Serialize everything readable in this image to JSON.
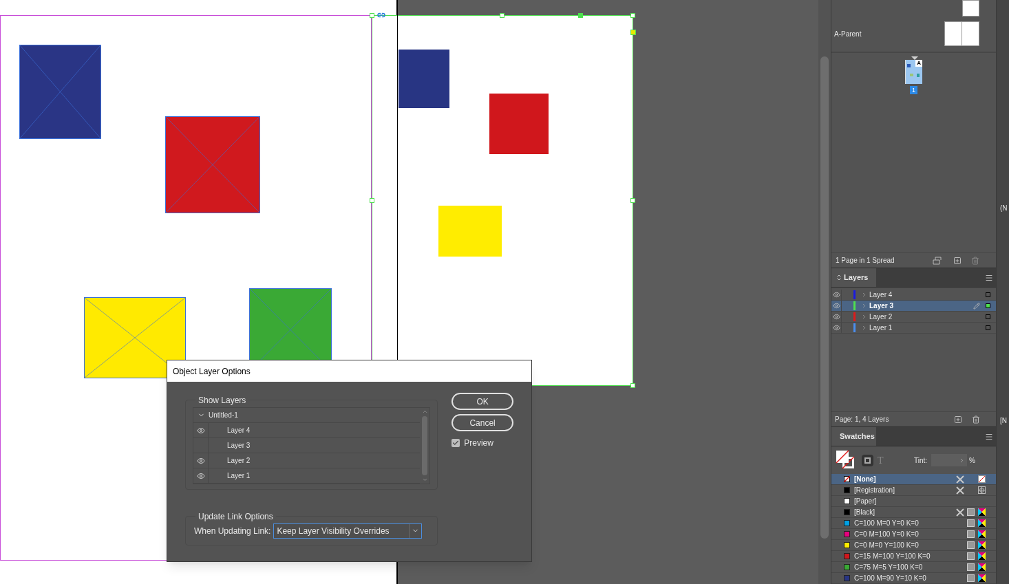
{
  "canvas": {
    "page_items": [
      {
        "color": "#2a3585",
        "crossed": true
      },
      {
        "color": "#d0191e",
        "crossed": true
      },
      {
        "color": "#ffea00",
        "crossed": true
      },
      {
        "color": "#3aa935",
        "crossed": true
      }
    ],
    "placed_items": [
      {
        "color": "#283583",
        "crossed": false
      },
      {
        "color": "#d0171c",
        "crossed": false
      },
      {
        "color": "#ffed00",
        "crossed": false
      }
    ]
  },
  "pages_panel": {
    "parents": [
      {
        "name": "A-Parent"
      }
    ],
    "page_thumb": {
      "parent_letter": "A",
      "number": "1",
      "selected": true
    },
    "status": "1 Page in 1 Spread"
  },
  "layers_panel": {
    "tab": "Layers",
    "layers": [
      {
        "name": "Layer 4",
        "color": "#1a1ae0",
        "visible": true,
        "selected": false
      },
      {
        "name": "Layer 3",
        "color": "#4fe04f",
        "visible": true,
        "selected": true
      },
      {
        "name": "Layer 2",
        "color": "#e01a1a",
        "visible": true,
        "selected": false
      },
      {
        "name": "Layer 1",
        "color": "#4a8ff0",
        "visible": true,
        "selected": false
      }
    ],
    "status": "Page: 1, 4 Layers"
  },
  "swatches_panel": {
    "tab": "Swatches",
    "text_mode_glyph": "T",
    "tint_label": "Tint:",
    "tint_unit": "%",
    "swatches": [
      {
        "name": "[None]",
        "kind": "none",
        "locked": true,
        "selected": true
      },
      {
        "name": "[Registration]",
        "kind": "registration",
        "color": "#000000",
        "locked": true,
        "selected": false
      },
      {
        "name": "[Paper]",
        "kind": "paper",
        "color": "#ffffff",
        "locked": false,
        "selected": false
      },
      {
        "name": "[Black]",
        "kind": "process",
        "color": "#000000",
        "locked": true,
        "selected": false
      },
      {
        "name": "C=100 M=0 Y=0 K=0",
        "kind": "process",
        "color": "#009fe3",
        "locked": false,
        "selected": false
      },
      {
        "name": "C=0 M=100 Y=0 K=0",
        "kind": "process",
        "color": "#e6007e",
        "locked": false,
        "selected": false
      },
      {
        "name": "C=0 M=0 Y=100 K=0",
        "kind": "process",
        "color": "#ffed00",
        "locked": false,
        "selected": false
      },
      {
        "name": "C=15 M=100 Y=100 K=0",
        "kind": "process",
        "color": "#d0171c",
        "locked": false,
        "selected": false
      },
      {
        "name": "C=75 M=5 Y=100 K=0",
        "kind": "process",
        "color": "#3aa935",
        "locked": false,
        "selected": false
      },
      {
        "name": "C=100 M=90 Y=10 K=0",
        "kind": "process",
        "color": "#283583",
        "locked": false,
        "selected": false
      }
    ]
  },
  "side_strip": {
    "texts": [
      "(N",
      "[N"
    ]
  },
  "dialog": {
    "title": "Object Layer Options",
    "show_layers": {
      "label": "Show Layers",
      "document": "Untitled-1",
      "expanded": true,
      "layers": [
        {
          "name": "Layer 4",
          "visible": true
        },
        {
          "name": "Layer 3",
          "visible": false
        },
        {
          "name": "Layer 2",
          "visible": true
        },
        {
          "name": "Layer 1",
          "visible": true
        }
      ]
    },
    "update_link": {
      "label": "Update Link Options",
      "field_label": "When Updating Link:",
      "value": "Keep Layer Visibility Overrides"
    },
    "buttons": [
      {
        "label": "OK"
      },
      {
        "label": "Cancel"
      }
    ],
    "preview": {
      "label": "Preview",
      "checked": true
    }
  }
}
